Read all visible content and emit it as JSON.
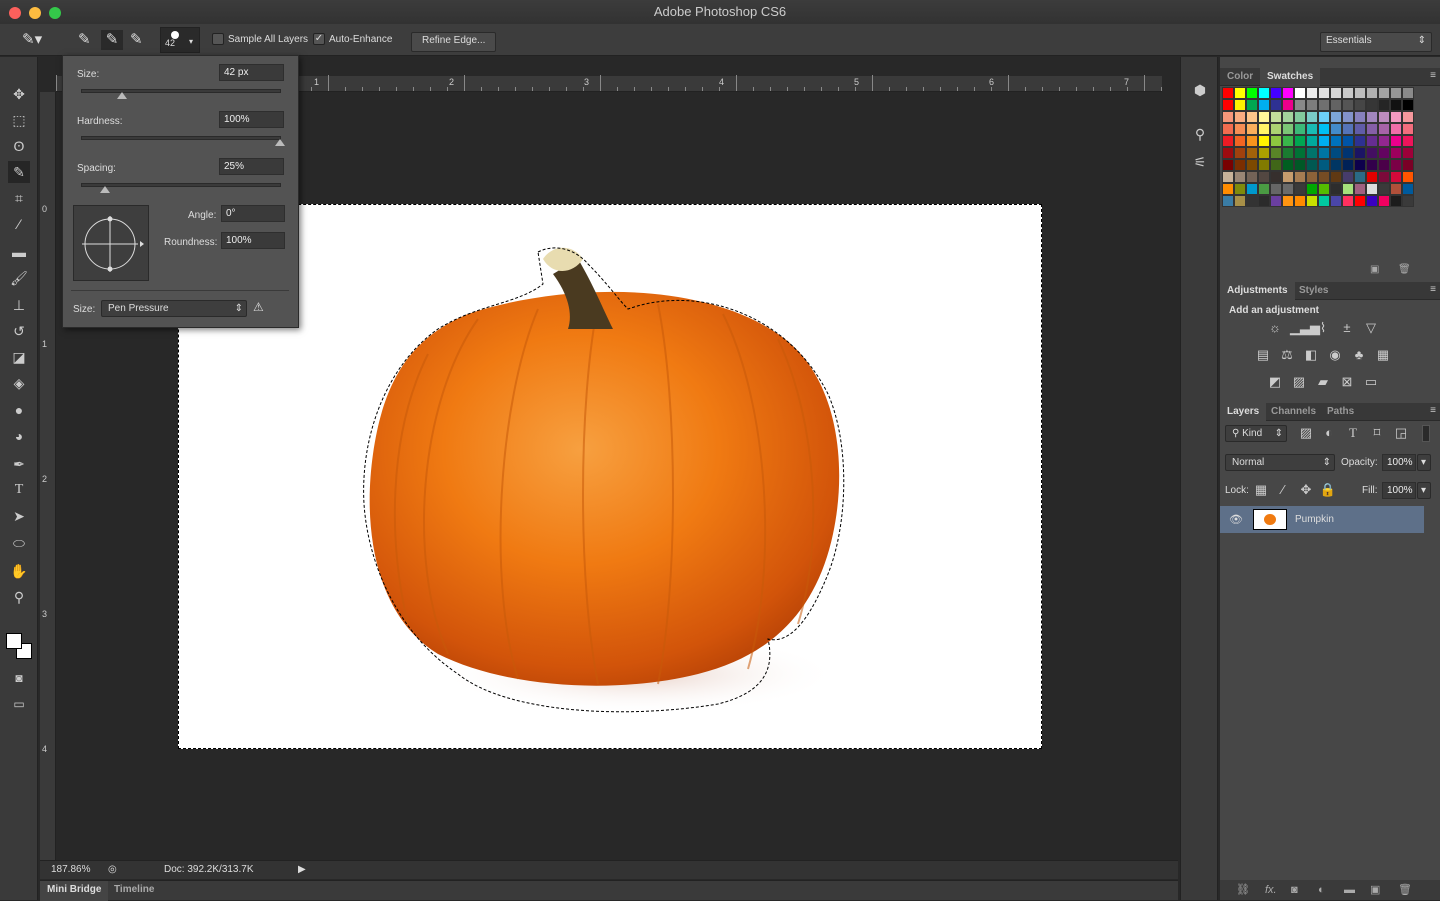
{
  "app": {
    "title": "Adobe Photoshop CS6",
    "workspace": "Essentials"
  },
  "options_bar": {
    "brush_size": "42",
    "sample_all_layers": {
      "label": "Sample All Layers",
      "checked": false
    },
    "auto_enhance": {
      "label": "Auto-Enhance",
      "checked": true
    },
    "refine_edge": "Refine Edge...",
    "tool_icons": [
      "quick-selection-tool-icon",
      "new-selection-icon",
      "add-to-selection-icon",
      "subtract-from-selection-icon"
    ]
  },
  "brush_popup": {
    "size_label": "Size:",
    "size_value": "42 px",
    "size_fraction": 0.2,
    "hardness_label": "Hardness:",
    "hardness_value": "100%",
    "hardness_fraction": 1.0,
    "spacing_label": "Spacing:",
    "spacing_value": "25%",
    "spacing_fraction": 0.12,
    "angle_label": "Angle:",
    "angle_value": "0°",
    "roundness_label": "Roundness:",
    "roundness_value": "100%",
    "size_control_label": "Size:",
    "size_control_value": "Pen Pressure"
  },
  "tools": [
    "move",
    "rectangular-marquee",
    "lasso",
    "quick-selection",
    "crop",
    "eyedropper",
    "spot-healing-brush",
    "brush",
    "clone-stamp",
    "history-brush",
    "eraser",
    "paint-bucket",
    "blur",
    "dodge",
    "pen",
    "type",
    "path-selection",
    "ellipse",
    "hand",
    "zoom"
  ],
  "rulers": {
    "horizontal": [
      "1",
      "2",
      "3",
      "4",
      "5",
      "6",
      "7"
    ],
    "vertical": [
      "0",
      "1",
      "2",
      "3",
      "4"
    ]
  },
  "status": {
    "zoom": "187.86%",
    "doc": "Doc: 392.2K/313.7K"
  },
  "bottom_tabs": [
    "Mini Bridge",
    "Timeline"
  ],
  "color_panel": {
    "tabs": [
      "Color",
      "Swatches"
    ],
    "active": "Swatches",
    "swatches": [
      "#ff0000",
      "#ffff00",
      "#00ff00",
      "#00ffff",
      "#4400ff",
      "#ff00ff",
      "#ffffff",
      "#ebebeb",
      "#e0e0e0",
      "#d6d6d6",
      "#c9c9c9",
      "#bdbdbd",
      "#b0b0b0",
      "#a3a3a3",
      "#969696",
      "#8a8a8a",
      "#ff0000",
      "#fff200",
      "#00a651",
      "#00aeef",
      "#2e3192",
      "#ec008c",
      "#898989",
      "#7d7d7d",
      "#707070",
      "#636363",
      "#555555",
      "#464646",
      "#363636",
      "#252525",
      "#111111",
      "#000000",
      "#f7977a",
      "#f9ad81",
      "#fdc68a",
      "#fff79a",
      "#c4df9b",
      "#a3d39c",
      "#82ca9d",
      "#7accc8",
      "#6dcff6",
      "#7da7d9",
      "#8393ca",
      "#8781bd",
      "#a186be",
      "#bd8cbf",
      "#f49ac2",
      "#f6989d",
      "#f26c4f",
      "#f68e55",
      "#fbaf5c",
      "#fff467",
      "#acd372",
      "#7cc576",
      "#3bb878",
      "#1abbb4",
      "#00bff3",
      "#438ccb",
      "#5574b9",
      "#605ca8",
      "#855fa8",
      "#a763a8",
      "#f06ea9",
      "#f26d7d",
      "#ed1c24",
      "#f26522",
      "#f7941d",
      "#fff200",
      "#8dc73f",
      "#39b54a",
      "#00a651",
      "#00a99d",
      "#00aeef",
      "#0072bc",
      "#0054a6",
      "#2e3192",
      "#662d91",
      "#92278f",
      "#ec008c",
      "#ed145b",
      "#9e0b0f",
      "#a0410d",
      "#a3620a",
      "#aba000",
      "#598527",
      "#1a7b30",
      "#007236",
      "#00746b",
      "#0076a3",
      "#004b80",
      "#003471",
      "#1b1464",
      "#440e62",
      "#630460",
      "#9e005d",
      "#9e0039",
      "#790000",
      "#7b2e00",
      "#7d4900",
      "#827b00",
      "#406618",
      "#005e20",
      "#005826",
      "#005952",
      "#005b7f",
      "#003663",
      "#002157",
      "#0d004c",
      "#32004b",
      "#4b0049",
      "#7b0046",
      "#7a0026",
      "#c7b299",
      "#998675",
      "#736357",
      "#534741",
      "#362f2d",
      "#c69c6d",
      "#a67c52",
      "#8c6239",
      "#754c24",
      "#603913",
      "#463c6b",
      "#2a6a86",
      "#e10000",
      "#7b0a3a",
      "#d40a3a",
      "#ff5500",
      "#ff8c00",
      "#7f8b0c",
      "#0099cc",
      "#4a9b43",
      "#666666",
      "#6b6b6b",
      "#3a3a3a",
      "#00a800",
      "#55bb00",
      "#2d2d2d",
      "#a5e07c",
      "#a06080",
      "#dddddd",
      "#3a3a3a",
      "#b0503a",
      "#005a9c",
      "#3a7ca5",
      "#a89048",
      "#333333",
      "#2b2b2b",
      "#6a3fa0",
      "#ff9411",
      "#ff8a00",
      "#c8e000",
      "#00c8a0",
      "#4a46a8",
      "#ff3060",
      "#ff0000",
      "#3a00c0",
      "#f00060",
      "#1c1c1c",
      "#3a3a3a"
    ]
  },
  "adjustments_panel": {
    "tabs": [
      "Adjustments",
      "Styles"
    ],
    "heading": "Add an adjustment",
    "rows": [
      [
        "brightness-contrast",
        "levels",
        "curves",
        "exposure",
        "vibrance"
      ],
      [
        "hue-saturation",
        "color-balance",
        "black-white",
        "photo-filter",
        "channel-mixer",
        "color-lookup"
      ],
      [
        "invert",
        "posterize",
        "threshold",
        "selective-color",
        "gradient-map"
      ]
    ]
  },
  "layers_panel": {
    "tabs": [
      "Layers",
      "Channels",
      "Paths"
    ],
    "filter": "Kind",
    "blend_mode": "Normal",
    "opacity_label": "Opacity:",
    "opacity": "100%",
    "lock_label": "Lock:",
    "fill_label": "Fill:",
    "fill": "100%",
    "layers": [
      {
        "name": "Pumpkin",
        "visible": true,
        "selected": true
      }
    ]
  },
  "colors": {
    "foreground": "#ffffff",
    "background": "#ffffff",
    "selected_layer": "#5e7089",
    "pumpkin": "#f07a10"
  }
}
